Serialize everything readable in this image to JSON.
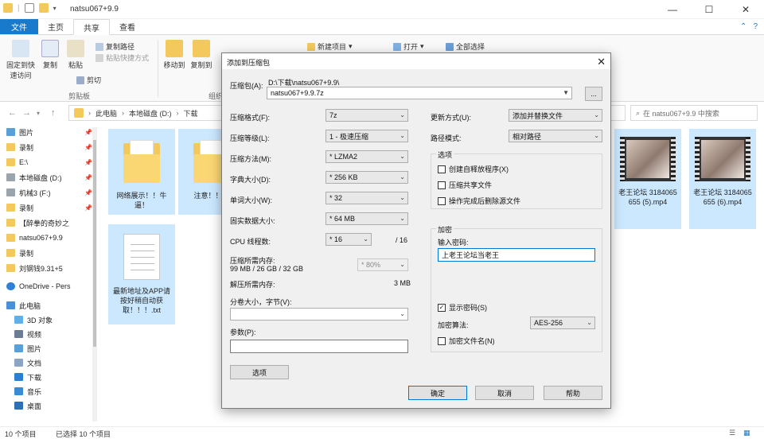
{
  "window": {
    "title": "natsu067+9.9"
  },
  "ribbon_tabs": [
    "文件",
    "主页",
    "共享",
    "查看"
  ],
  "ribbon": {
    "pin_label": "固定到快速访问",
    "copy_label": "复制",
    "paste_label": "粘贴",
    "copy_path_label": "复制路径",
    "paste_shortcut_label": "粘贴快捷方式",
    "cut_label": "剪切",
    "clipboard_group": "剪贴板",
    "move_to_label": "移动到",
    "copy_to_label": "复制到",
    "organize_group": "组织",
    "new_item_label": "新建项目",
    "open_label": "打开",
    "select_all_label": "全部选择"
  },
  "address": {
    "segments": [
      "此电脑",
      "本地磁盘 (D:)",
      "下载"
    ],
    "search_placeholder": "在 natsu067+9.9 中搜索"
  },
  "nav": {
    "items": [
      {
        "label": "图片",
        "pinned": "📌"
      },
      {
        "label": "录制",
        "pinned": "📌"
      },
      {
        "label": "E:\\",
        "pinned": "📌"
      },
      {
        "label": "本地磁盘 (D:)",
        "pinned": "📌"
      },
      {
        "label": "机械3 (F:)",
        "pinned": "📌"
      },
      {
        "label": "录制",
        "pinned": "📌"
      },
      {
        "label": "【醉拳的奇妙之",
        "pinned": ""
      },
      {
        "label": "natsu067+9.9",
        "pinned": ""
      },
      {
        "label": "录制",
        "pinned": ""
      },
      {
        "label": "刘钢钱9.31+5",
        "pinned": ""
      },
      {
        "label": "OneDrive - Pers",
        "pinned": ""
      },
      {
        "label": "此电脑",
        "pinned": ""
      },
      {
        "label": "3D 对象",
        "pinned": ""
      },
      {
        "label": "视频",
        "pinned": ""
      },
      {
        "label": "图片",
        "pinned": ""
      },
      {
        "label": "文档",
        "pinned": ""
      },
      {
        "label": "下载",
        "pinned": ""
      },
      {
        "label": "音乐",
        "pinned": ""
      },
      {
        "label": "桌面",
        "pinned": ""
      }
    ]
  },
  "files": [
    {
      "name": "网络展示！！牛逼！"
    },
    {
      "name": "注意！！！"
    },
    {
      "name": "最新地址及APP请按好稍自动获取！！！.txt"
    },
    {
      "name": "老王论坛 3184065655 (5).mp4"
    },
    {
      "name": "老王论坛 3184065655 (6).mp4"
    }
  ],
  "status": {
    "count": "10 个项目",
    "selected": "已选择 10 个项目"
  },
  "dialog": {
    "title": "添加到压缩包",
    "archive_label": "压缩包(A):",
    "archive_path": "D:\\下载\\natsu067+9.9\\",
    "archive_name": "natsu067+9.9.7z",
    "browse_label": "...",
    "format_label": "压缩格式(F):",
    "format_value": "7z",
    "level_label": "压缩等级(L):",
    "level_value": "1 - 极速压缩",
    "method_label": "压缩方法(M):",
    "method_value": "* LZMA2",
    "dict_label": "字典大小(D):",
    "dict_value": "* 256 KB",
    "word_label": "单词大小(W):",
    "word_value": "* 32",
    "solid_label": "固实数据大小:",
    "solid_value": "* 64 MB",
    "cpu_label": "CPU 线程数:",
    "cpu_value": "* 16",
    "cpu_total": "/ 16",
    "mem_label": "压缩所需内存:",
    "mem_detail": "99 MB / 26 GB / 32 GB",
    "mem_percent": "* 80%",
    "decomp_label": "解压所需内存:",
    "decomp_value": "3 MB",
    "split_label": "分卷大小，字节(V):",
    "split_value": "",
    "params_label": "参数(P):",
    "params_value": "",
    "options_button": "选项",
    "update_label": "更新方式(U):",
    "update_value": "添加并替换文件",
    "path_label": "路径模式:",
    "path_value": "相对路径",
    "opts_group": "选项",
    "opt_sfx": "创建自释放程序(X)",
    "opt_shared": "压缩共享文件",
    "opt_delete": "操作完成后删除源文件",
    "enc_group": "加密",
    "password_label": "输入密码:",
    "password_value": "上老王论坛当老王",
    "show_password": "显示密码(S)",
    "enc_method_label": "加密算法:",
    "enc_method_value": "AES-256",
    "enc_names": "加密文件名(N)",
    "ok": "确定",
    "cancel": "取消",
    "help": "帮助"
  }
}
